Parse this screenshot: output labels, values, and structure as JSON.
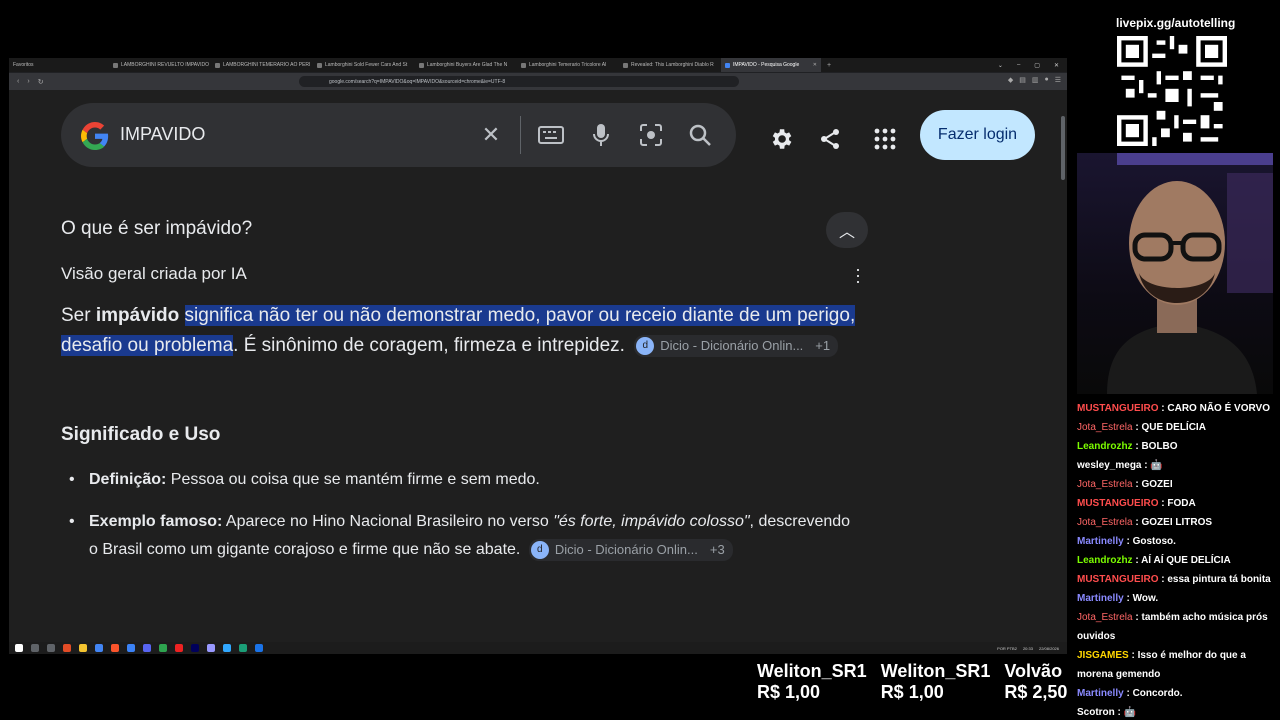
{
  "browser": {
    "tabs": [
      {
        "label": "Favoritos",
        "active": false
      },
      {
        "label": "LAMBORGHINI REVUELTO IMPAVIDO",
        "active": false
      },
      {
        "label": "LAMBORGHINI TEMERARIO AO PERI",
        "active": false
      },
      {
        "label": "Lamborghini Sold Fewer Cars And St",
        "active": false
      },
      {
        "label": "Lamborghini Buyers Are Glad The N",
        "active": false
      },
      {
        "label": "Lamborghini Temerario Tricolore Al",
        "active": false
      },
      {
        "label": "Revealed: This Lamborghini Diablo R",
        "active": false
      },
      {
        "label": "IMPAVIDO - Pesquisa Google",
        "active": true
      }
    ],
    "url": "google.com/search?q=IMPAVIDO&oq=IMPAVIDO&sourceid=chrome&ie=UTF-8"
  },
  "search": {
    "query": "IMPAVIDO",
    "login_label": "Fazer login"
  },
  "overview": {
    "question": "O que é ser impávido?",
    "header": "Visão geral criada por IA",
    "answer_pre": "Ser ",
    "answer_bold": "impávido",
    "answer_highlight": "significa não ter ou não demonstrar medo, pavor ou receio diante de um perigo, desafio ou problema",
    "answer_post": ". É sinônimo de coragem, firmeza e intrepidez.",
    "source1": "Dicio - Dicionário Onlin...",
    "source1_more": "+1",
    "section_title": "Significado e Uso",
    "def_label": "Definição:",
    "def_text": " Pessoa ou coisa que se mantém firme e sem medo.",
    "ex_label": "Exemplo famoso:",
    "ex_text1": " Aparece no Hino Nacional Brasileiro no verso ",
    "ex_quote": "\"és forte, impávido colosso\"",
    "ex_text2": ", descrevendo o Brasil como um gigante corajoso e firme que não se abate.",
    "source2": "Dicio - Dicionário Onlin...",
    "source2_more": "+3"
  },
  "taskbar": {
    "lang": "POR PTB2",
    "time": "20:33",
    "date": "22/08/2026"
  },
  "stream": {
    "qr_title": "livepix.gg/autotelling",
    "chat": [
      {
        "user": "MUSTANGUEIRO",
        "text": "CARO NÃO É VORVO",
        "cls": "u1"
      },
      {
        "user": "Jota_Estrela",
        "text": "QUE DELÍCIA",
        "cls": "u2"
      },
      {
        "user": "Leandrozhz",
        "text": "BOLBO",
        "cls": "u3"
      },
      {
        "user": "wesley_mega",
        "text": "🤖",
        "cls": "u4"
      },
      {
        "user": "Jota_Estrela",
        "text": "GOZEI",
        "cls": "u2"
      },
      {
        "user": "MUSTANGUEIRO",
        "text": "FODA",
        "cls": "u1"
      },
      {
        "user": "Jota_Estrela",
        "text": "GOZEI LITROS",
        "cls": "u2"
      },
      {
        "user": "Martinelly",
        "text": "Gostoso.",
        "cls": "u5"
      },
      {
        "user": "Leandrozhz",
        "text": "AÍ AÍ QUE DELÍCIA",
        "cls": "u3"
      },
      {
        "user": "MUSTANGUEIRO",
        "text": "essa pintura tá bonita",
        "cls": "u1"
      },
      {
        "user": "Martinelly",
        "text": "Wow.",
        "cls": "u5"
      },
      {
        "user": "Jota_Estrela",
        "text": "também acho música prós ouvidos",
        "cls": "u2"
      },
      {
        "user": "JISGAMES",
        "text": "Isso é melhor do que a morena gemendo",
        "cls": "u6"
      },
      {
        "user": "Martinelly",
        "text": "Concordo.",
        "cls": "u5"
      },
      {
        "user": "Scotron",
        "text": "🤖",
        "cls": "u4"
      }
    ],
    "donations": [
      {
        "name": "Weliton_SR1",
        "value": "R$ 1,00"
      },
      {
        "name": "Weliton_SR1",
        "value": "R$ 1,00"
      },
      {
        "name": "Volvão",
        "value": "R$ 2,50"
      }
    ]
  }
}
